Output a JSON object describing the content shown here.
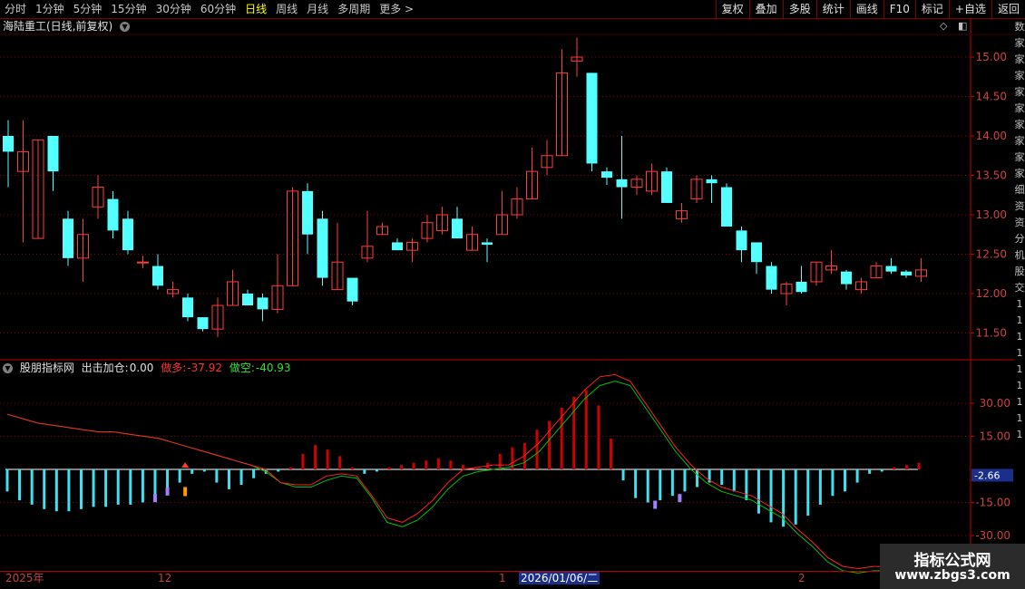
{
  "toolbar": {
    "periods": [
      "分时",
      "1分钟",
      "5分钟",
      "15分钟",
      "30分钟",
      "60分钟",
      "日线",
      "周线",
      "月线",
      "多周期",
      "更多"
    ],
    "active_period": "日线",
    "buttons": [
      "复权",
      "叠加",
      "多股",
      "统计",
      "画线",
      "F10",
      "标记",
      "+自选",
      "返回"
    ]
  },
  "main_title": "海陆重工(日线,前复权)",
  "price_axis": [
    "15.00",
    "14.50",
    "14.00",
    "13.50",
    "13.00",
    "12.50",
    "12.00",
    "11.50"
  ],
  "candles": [
    [
      14.0,
      13.8,
      13.35,
      14.2
    ],
    [
      13.55,
      13.8,
      12.65,
      14.2
    ],
    [
      12.7,
      13.95,
      12.7,
      13.95
    ],
    [
      14.0,
      13.55,
      13.3,
      14.0
    ],
    [
      12.95,
      12.45,
      12.35,
      13.05
    ],
    [
      12.45,
      12.75,
      12.15,
      12.95
    ],
    [
      13.1,
      13.35,
      12.95,
      13.5
    ],
    [
      13.2,
      12.8,
      12.7,
      13.3
    ],
    [
      12.95,
      12.55,
      12.5,
      13.05
    ],
    [
      12.4,
      12.4,
      12.32,
      12.48
    ],
    [
      12.35,
      12.1,
      12.05,
      12.5
    ],
    [
      12.0,
      12.05,
      11.95,
      12.15
    ],
    [
      11.95,
      11.7,
      11.65,
      12.0
    ],
    [
      11.7,
      11.55,
      11.52,
      11.7
    ],
    [
      11.55,
      11.85,
      11.45,
      11.95
    ],
    [
      11.85,
      12.15,
      11.85,
      12.3
    ],
    [
      12.0,
      11.85,
      11.85,
      12.05
    ],
    [
      11.95,
      11.8,
      11.65,
      12.0
    ],
    [
      11.8,
      12.1,
      11.75,
      12.5
    ],
    [
      12.1,
      13.3,
      12.1,
      13.35
    ],
    [
      13.3,
      12.75,
      12.5,
      13.4
    ],
    [
      12.95,
      12.2,
      12.1,
      13.05
    ],
    [
      12.05,
      12.4,
      12.05,
      12.9
    ],
    [
      12.2,
      11.9,
      11.85,
      12.2
    ],
    [
      12.45,
      12.6,
      12.4,
      13.05
    ],
    [
      12.75,
      12.85,
      12.75,
      12.9
    ],
    [
      12.65,
      12.55,
      12.55,
      12.7
    ],
    [
      12.55,
      12.65,
      12.4,
      12.7
    ],
    [
      12.7,
      12.9,
      12.65,
      13.0
    ],
    [
      12.8,
      13.0,
      12.75,
      13.1
    ],
    [
      12.95,
      12.7,
      12.7,
      13.1
    ],
    [
      12.55,
      12.75,
      12.55,
      12.85
    ],
    [
      12.65,
      12.62,
      12.4,
      12.7
    ],
    [
      12.75,
      13.0,
      12.75,
      13.3
    ],
    [
      13.0,
      13.2,
      12.95,
      13.35
    ],
    [
      13.2,
      13.55,
      13.2,
      13.85
    ],
    [
      13.6,
      13.75,
      13.5,
      13.95
    ],
    [
      13.75,
      14.8,
      13.75,
      15.1
    ],
    [
      14.95,
      15.0,
      14.75,
      15.25
    ],
    [
      14.8,
      13.65,
      13.55,
      14.8
    ],
    [
      13.55,
      13.47,
      13.38,
      13.6
    ],
    [
      13.45,
      13.35,
      12.95,
      14.0
    ],
    [
      13.35,
      13.45,
      13.25,
      13.5
    ],
    [
      13.3,
      13.55,
      13.25,
      13.65
    ],
    [
      13.55,
      13.15,
      13.15,
      13.6
    ],
    [
      12.95,
      13.05,
      12.9,
      13.15
    ],
    [
      13.2,
      13.45,
      13.15,
      13.5
    ],
    [
      13.45,
      13.4,
      13.15,
      13.5
    ],
    [
      13.35,
      12.85,
      12.85,
      13.4
    ],
    [
      12.8,
      12.55,
      12.4,
      12.85
    ],
    [
      12.65,
      12.4,
      12.25,
      12.65
    ],
    [
      12.35,
      12.05,
      12.0,
      12.4
    ],
    [
      12.0,
      12.12,
      11.85,
      12.15
    ],
    [
      12.15,
      12.02,
      12.0,
      12.35
    ],
    [
      12.15,
      12.4,
      12.1,
      12.4
    ],
    [
      12.3,
      12.35,
      12.25,
      12.55
    ],
    [
      12.28,
      12.12,
      12.05,
      12.3
    ],
    [
      12.05,
      12.15,
      12.0,
      12.2
    ],
    [
      12.2,
      12.35,
      12.2,
      12.4
    ],
    [
      12.35,
      12.28,
      12.25,
      12.45
    ],
    [
      12.28,
      12.23,
      12.2,
      12.3
    ],
    [
      12.22,
      12.3,
      12.15,
      12.45
    ]
  ],
  "indicator": {
    "name": "股朋指标网",
    "label1": "出击加仓:",
    "value1": "0.00",
    "label2": "做多:",
    "value2": "-37.92",
    "label3": "做空:",
    "value3": "-40.93",
    "axis": [
      "30.00",
      "15.00",
      "-15.00",
      "-30.00"
    ],
    "current_value": "-2.66",
    "colors": {
      "up": "#ff2020",
      "down": "#00c000",
      "bar_pos": "#cc0000",
      "bar_neg": "#40e0f0",
      "accent": "#ff9900",
      "marker": "#a080ff"
    }
  },
  "histogram": [
    -10,
    -14,
    -16,
    -18,
    -19,
    -19,
    -18,
    -17,
    -17,
    -16,
    -16,
    -15,
    -12,
    -9,
    -6,
    -2,
    -1,
    -6,
    -9,
    -7,
    -4,
    -2,
    -1,
    1,
    7,
    11,
    9,
    6,
    1,
    -2,
    -1,
    1,
    2,
    3,
    4,
    5,
    4,
    2,
    1,
    3,
    7,
    10,
    12,
    18,
    22,
    28,
    33,
    36,
    29,
    14,
    -5,
    -13,
    -15,
    -14,
    -12,
    -10,
    -8,
    -6,
    -7,
    -10,
    -14,
    -20,
    -24,
    -26,
    -25,
    -21,
    -16,
    -12,
    -10,
    -6,
    -2,
    -1,
    1,
    2,
    3
  ],
  "fast_line": [
    25,
    23,
    21,
    20,
    19,
    18,
    17,
    17,
    16,
    15,
    14,
    12,
    10,
    8,
    6,
    4,
    2,
    0,
    -6,
    -7,
    -7,
    -3,
    -2,
    -3,
    -12,
    -22,
    -24,
    -20,
    -14,
    -6,
    0,
    1,
    2,
    2,
    6,
    12,
    20,
    28,
    36,
    42,
    43,
    40,
    30,
    20,
    10,
    2,
    -4,
    -8,
    -10,
    -12,
    -16,
    -20,
    -27,
    -33,
    -40,
    -44,
    -45,
    -44,
    -44,
    -43,
    -42
  ],
  "slow_line": [
    25,
    23,
    21,
    20,
    19,
    18,
    17,
    17,
    16,
    15,
    14,
    12,
    10,
    8,
    6,
    4,
    2,
    -1,
    -6,
    -8,
    -8,
    -5,
    -3,
    -4,
    -13,
    -24,
    -26,
    -23,
    -17,
    -9,
    -3,
    -1,
    0,
    1,
    3,
    8,
    16,
    24,
    32,
    38,
    40,
    38,
    28,
    18,
    8,
    0,
    -6,
    -10,
    -12,
    -14,
    -18,
    -22,
    -29,
    -35,
    -42,
    -46,
    -47,
    -46,
    -46,
    -45,
    -43
  ],
  "date_axis": {
    "year": "2025年",
    "m12": "12",
    "m1": "1",
    "selected": "2026/01/06/二",
    "m2": "2"
  },
  "side_chars": [
    "数",
    "家",
    "家",
    "家",
    "家",
    "家",
    "家",
    "家",
    "家",
    "家",
    "细",
    "资",
    "资",
    "分",
    "机",
    "股",
    "交",
    "1",
    "1",
    "1",
    "1",
    "1",
    "1",
    "1",
    "1",
    "1"
  ],
  "watermark": {
    "line1": "指标公式网",
    "line2": "www.zbgs3.com"
  }
}
